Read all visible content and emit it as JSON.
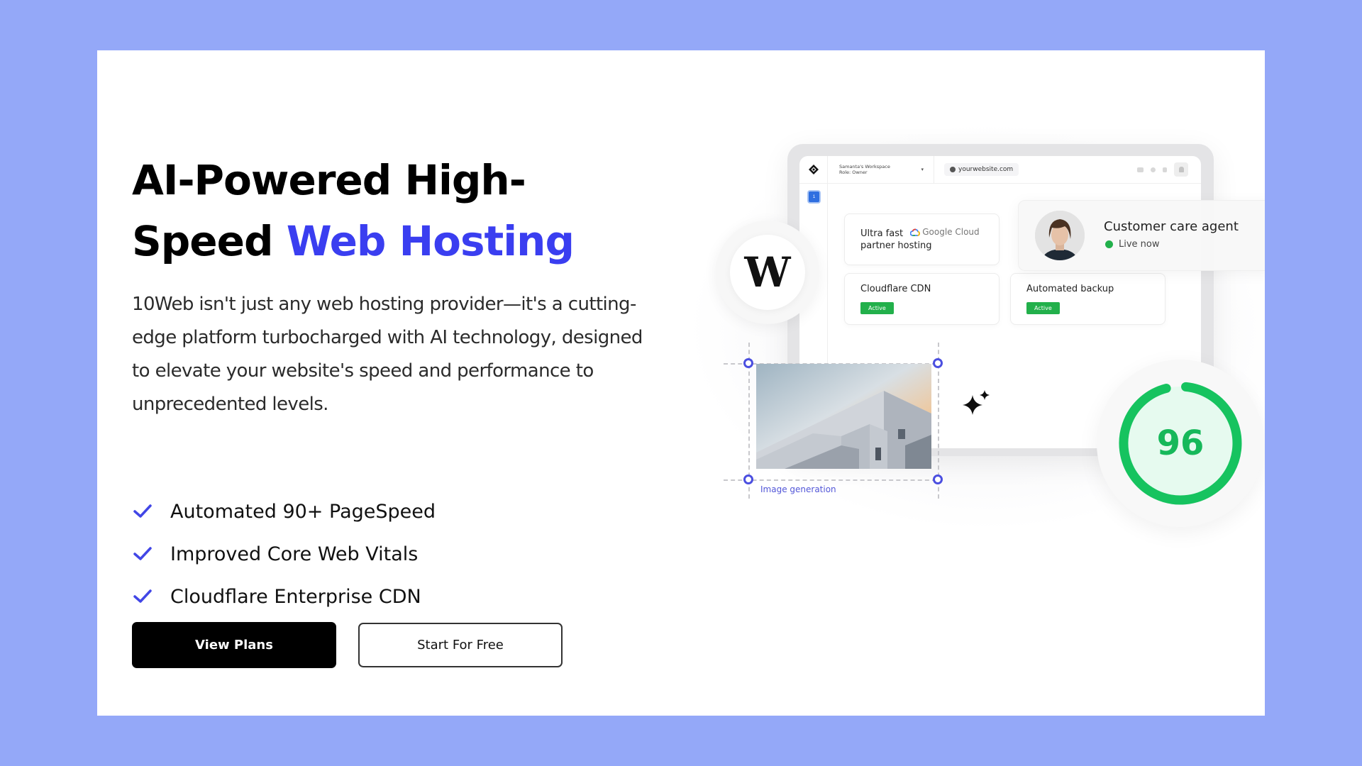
{
  "hero": {
    "headline_part1": "AI-Powered High-",
    "headline_part2": "Speed ",
    "headline_accent": "Web Hosting",
    "description": "10Web isn't just any web hosting provider—it's a cutting-edge platform turbocharged with AI technology, designed to elevate your website's speed and performance to unprecedented levels.",
    "features": [
      {
        "icon": "check-icon",
        "label": "Automated 90+ PageSpeed"
      },
      {
        "icon": "check-icon",
        "label": "Improved Core Web Vitals"
      },
      {
        "icon": "check-icon",
        "label": "Cloudflare Enterprise CDN"
      }
    ],
    "primary_button": "View Plans",
    "secondary_button": "Start For Free"
  },
  "dashboard": {
    "workspace_name": "Samanta's Workspace",
    "workspace_role": "Role: Owner",
    "url": "yourwebsite.com",
    "sidebar_badge": "1",
    "cards": {
      "google": {
        "prefix": "Ultra fast",
        "brand": "Google Cloud",
        "suffix": "partner hosting"
      },
      "cdn": {
        "title": "Cloudflare CDN",
        "status": "Active"
      },
      "backup": {
        "title": "Automated backup",
        "status": "Active"
      }
    }
  },
  "agent": {
    "title": "Customer care agent",
    "status": "Live now"
  },
  "wordpress_logo": "W",
  "image_generation": {
    "caption": "Image generation"
  },
  "pagespeed": {
    "score": "96",
    "fraction": 0.96
  },
  "colors": {
    "background": "#94a8f8",
    "accent": "#3a3ef0",
    "success": "#22b04b",
    "score": "#16c35f"
  }
}
